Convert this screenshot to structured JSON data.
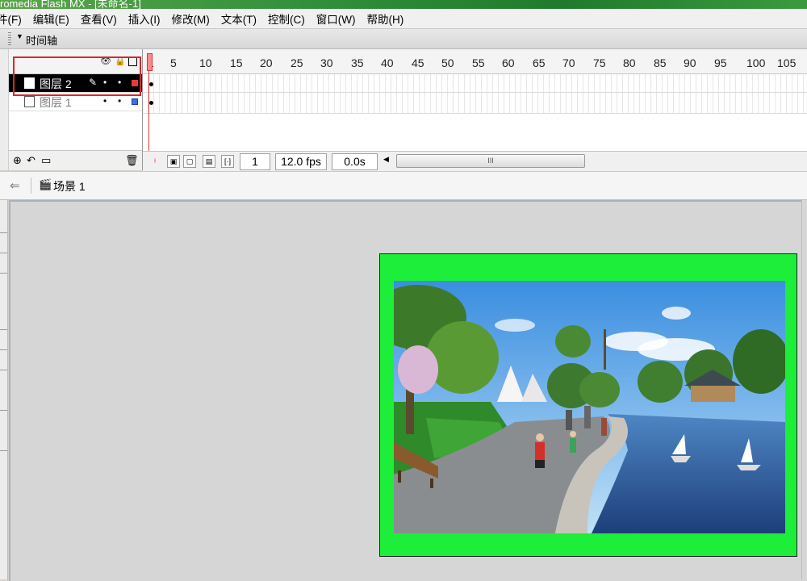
{
  "window": {
    "title": "romedia Flash MX - [未命名-1]"
  },
  "menu": [
    {
      "label": "件(F)"
    },
    {
      "label": "编辑(E)"
    },
    {
      "label": "查看(V)"
    },
    {
      "label": "插入(I)"
    },
    {
      "label": "修改(M)"
    },
    {
      "label": "文本(T)"
    },
    {
      "label": "控制(C)"
    },
    {
      "label": "窗口(W)"
    },
    {
      "label": "帮助(H)"
    }
  ],
  "timeline": {
    "title": "时间轴",
    "frame_ticks": [
      "1",
      "5",
      "10",
      "15",
      "20",
      "25",
      "30",
      "35",
      "40",
      "45",
      "50",
      "55",
      "60",
      "65",
      "70",
      "75",
      "80",
      "85",
      "90",
      "95",
      "100",
      "105"
    ],
    "layers": [
      {
        "name": "图层 2",
        "selected": true,
        "color": "#e53b3b"
      },
      {
        "name": "图层 1",
        "selected": false,
        "color": "#3b6fe5"
      }
    ],
    "current_frame": "1",
    "fps": "12.0 fps",
    "elapsed": "0.0s",
    "scroll_grip": "III"
  },
  "scene": {
    "name": "场景 1"
  },
  "stage": {
    "background": "#1dee39"
  },
  "icons": {
    "eye": "eye-icon",
    "lock": "lock-icon",
    "outline": "outline-icon",
    "add_layer": "add-layer-icon",
    "add_guide": "add-guide-layer-icon",
    "add_folder": "add-folder-icon",
    "delete": "trash-icon",
    "back": "back-arrow-icon",
    "scene": "scene-icon"
  }
}
